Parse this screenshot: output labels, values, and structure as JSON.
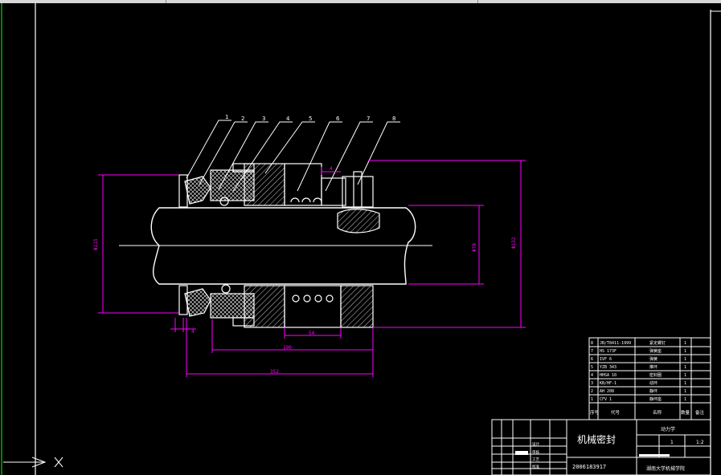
{
  "drawing": {
    "title": "机械密封",
    "drawing_number": "2006183917",
    "school": "湖南大学机械学院",
    "scale": "1:2",
    "sheet_info": "1",
    "part_group": "动力学",
    "balloons": [
      "1",
      "2",
      "3",
      "4",
      "5",
      "6",
      "7",
      "8"
    ],
    "dimensions": {
      "d_left": "Φ115",
      "d_shaft": "Φ70",
      "d_right": "Φ132",
      "gap_top": "4",
      "gap_bottom": "4",
      "spring_len": "54",
      "length_mid": "190",
      "length_total": "352"
    },
    "bom_header": {
      "no": "序号",
      "code": "代号",
      "name": "名称",
      "qty": "数量",
      "note": "备注"
    },
    "bom_rows": [
      {
        "no": "8",
        "code": "JB/T8411-1999",
        "name": "紧定螺钉",
        "qty": "1"
      },
      {
        "no": "7",
        "code": "HS 173F",
        "name": "弹簧座",
        "qty": "1"
      },
      {
        "no": "6",
        "code": "IVF 6",
        "name": "弹簧",
        "qty": "1"
      },
      {
        "no": "5",
        "code": "YZB 343",
        "name": "推环",
        "qty": "1"
      },
      {
        "no": "4",
        "code": "HHSA 10",
        "name": "密封圈",
        "qty": "1"
      },
      {
        "no": "3",
        "code": "KB/HF-1",
        "name": "动环",
        "qty": "1"
      },
      {
        "no": "2",
        "code": "AH 208",
        "name": "静环",
        "qty": "1"
      },
      {
        "no": "1",
        "code": "CFV 1",
        "name": "静环座",
        "qty": "1"
      }
    ],
    "title_block_labels": [
      "设计",
      "审核",
      "工艺",
      "批准"
    ],
    "colors": {
      "outline": "#ffffff",
      "dimension": "#ff00ff",
      "frame": "#ffffff",
      "hatch": "#ffffff"
    }
  }
}
